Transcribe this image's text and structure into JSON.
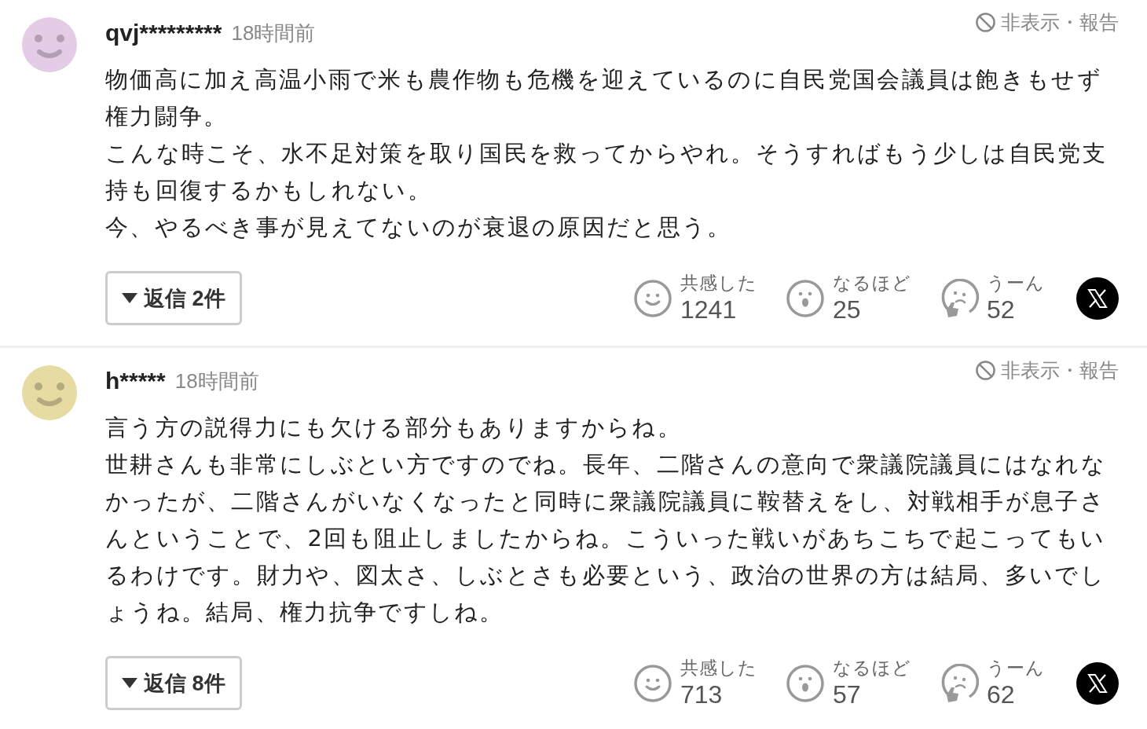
{
  "comments": [
    {
      "color": "#e4cce6",
      "user": "qvj*********",
      "time": "18時間前",
      "hide_report": "非表示・報告",
      "paragraphs": [
        "物価高に加え高温小雨で米も農作物も危機を迎えているのに自民党国会議員は飽きもせず権力闘争。",
        "こんな時こそ、水不足対策を取り国民を救ってからやれ。そうすればもう少しは自民党支持も回復するかもしれない。",
        "今、やるべき事が見えてないのが衰退の原因だと思う。"
      ],
      "replies_button": "返信 2件",
      "reactions": [
        {
          "kind": "smile",
          "label": "共感した",
          "count": "1241"
        },
        {
          "kind": "surprise",
          "label": "なるほど",
          "count": "25"
        },
        {
          "kind": "think",
          "label": "うーん",
          "count": "52"
        }
      ]
    },
    {
      "color": "#e5dba3",
      "user": "h*****",
      "time": "18時間前",
      "hide_report": "非表示・報告",
      "paragraphs": [
        "言う方の説得力にも欠ける部分もありますからね。",
        "世耕さんも非常にしぶとい方ですのでね。長年、二階さんの意向で衆議院議員にはなれなかったが、二階さんがいなくなったと同時に衆議院議員に鞍替えをし、対戦相手が息子さんということで、2回も阻止しましたからね。こういった戦いがあちこちで起こってもいるわけです。財力や、図太さ、しぶとさも必要という、政治の世界の方は結局、多いでしょうね。結局、権力抗争ですしね。"
      ],
      "replies_button": "返信 8件",
      "reactions": [
        {
          "kind": "smile",
          "label": "共感した",
          "count": "713"
        },
        {
          "kind": "surprise",
          "label": "なるほど",
          "count": "57"
        },
        {
          "kind": "think",
          "label": "うーん",
          "count": "62"
        }
      ]
    }
  ]
}
